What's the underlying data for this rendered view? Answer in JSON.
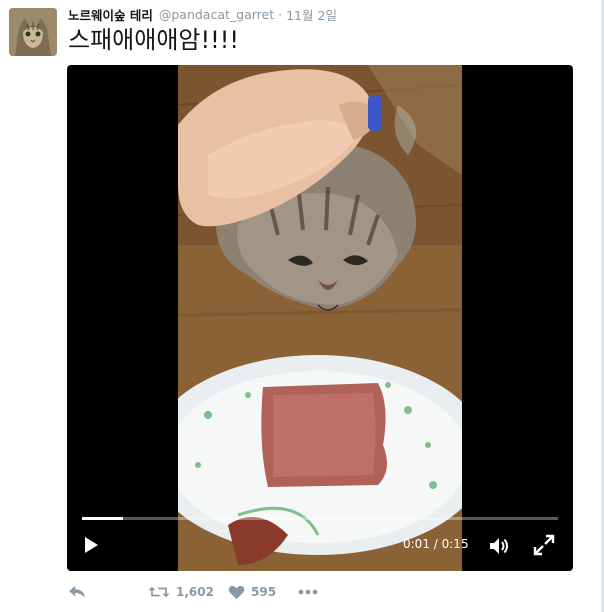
{
  "tweet": {
    "display_name": "노르웨이숲 테리",
    "handle": "@pandacat_garret",
    "separator": "·",
    "timestamp": "11월 2일",
    "text": "스패애애애암!!!!"
  },
  "video": {
    "current_time": "0:01",
    "duration": "0:15",
    "time_divider": " / ",
    "progress_fraction": 0.087
  },
  "actions": {
    "reply_icon": "reply-icon",
    "retweet_icon": "retweet-icon",
    "retweet_count": "1,602",
    "like_icon": "heart-icon",
    "like_count": "595",
    "more_icon": "more-icon"
  },
  "colors": {
    "text_primary": "#14171a",
    "text_secondary": "#8899a6",
    "video_bg": "#000000"
  }
}
